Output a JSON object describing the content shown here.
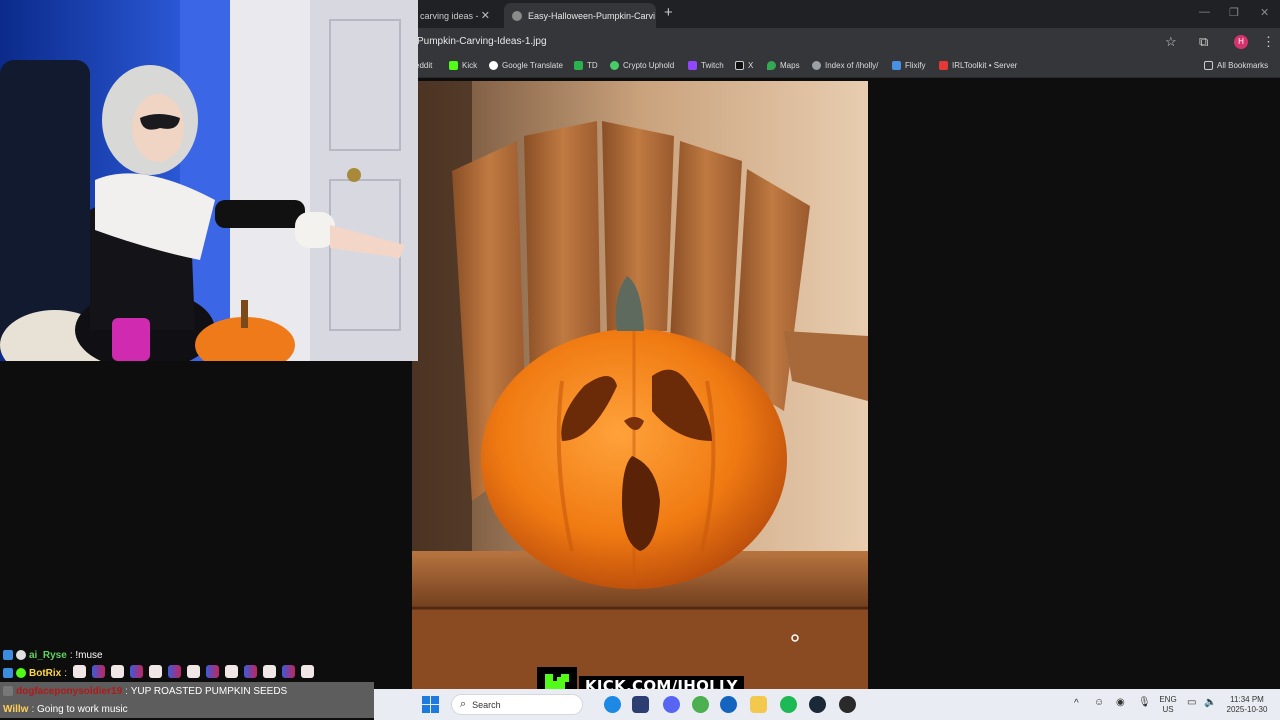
{
  "browser": {
    "tabs": [
      {
        "label": "carving ideas - ",
        "active": false
      },
      {
        "label": "Easy-Halloween-Pumpkin-Carvi",
        "active": true
      }
    ],
    "url": "Pumpkin-Carving-Ideas-1.jpg",
    "bookmarks": [
      {
        "label": "eddit",
        "icon": "reddit-icon",
        "color": "#ff4500"
      },
      {
        "label": "Kick",
        "icon": "kick-icon",
        "color": "#53fc18"
      },
      {
        "label": "Google Translate",
        "icon": "google-icon",
        "color": "#ffffff"
      },
      {
        "label": "TD",
        "icon": "td-icon",
        "color": "#2bb24c"
      },
      {
        "label": "Crypto Uphold",
        "icon": "uphold-icon",
        "color": "#49cc68"
      },
      {
        "label": "Twitch",
        "icon": "twitch-icon",
        "color": "#9146ff"
      },
      {
        "label": "X",
        "icon": "x-icon",
        "color": "#111111"
      },
      {
        "label": "Maps",
        "icon": "maps-icon",
        "color": "#34a853"
      },
      {
        "label": "Index of /iholly/",
        "icon": "globe-icon",
        "color": "#9aa0a6"
      },
      {
        "label": "Flixify",
        "icon": "flixify-icon",
        "color": "#4a90e2"
      },
      {
        "label": "IRLToolkit • Server",
        "icon": "irltoolkit-icon",
        "color": "#e53935"
      }
    ],
    "all_bookmarks": "All Bookmarks",
    "profile_initial": "H"
  },
  "chat": [
    {
      "user": "ai_Ryse",
      "message": "!muse",
      "user_color": "#5fd35f",
      "highlight": false,
      "emotes": 0
    },
    {
      "user": "BotRix",
      "message": "",
      "user_color": "#ffd84a",
      "highlight": false,
      "emotes": 13
    },
    {
      "user": "dogfaceponysoldier19",
      "message": "YUP ROASTED PUMPKIN SEEDS",
      "user_color": "#b01a1a",
      "highlight": true,
      "emotes": 0
    },
    {
      "user": "Willw",
      "message": "Going to work music",
      "user_color": "#ffcf5a",
      "highlight": true,
      "emotes": 0
    }
  ],
  "overlay": {
    "kick_url": "KICK.COM/IHOLLY",
    "kick_color": "#53fc18"
  },
  "taskbar": {
    "search_placeholder": "Search",
    "language": "ENG",
    "region": "US",
    "time": "11:34 PM",
    "date": "2025-10-30"
  }
}
